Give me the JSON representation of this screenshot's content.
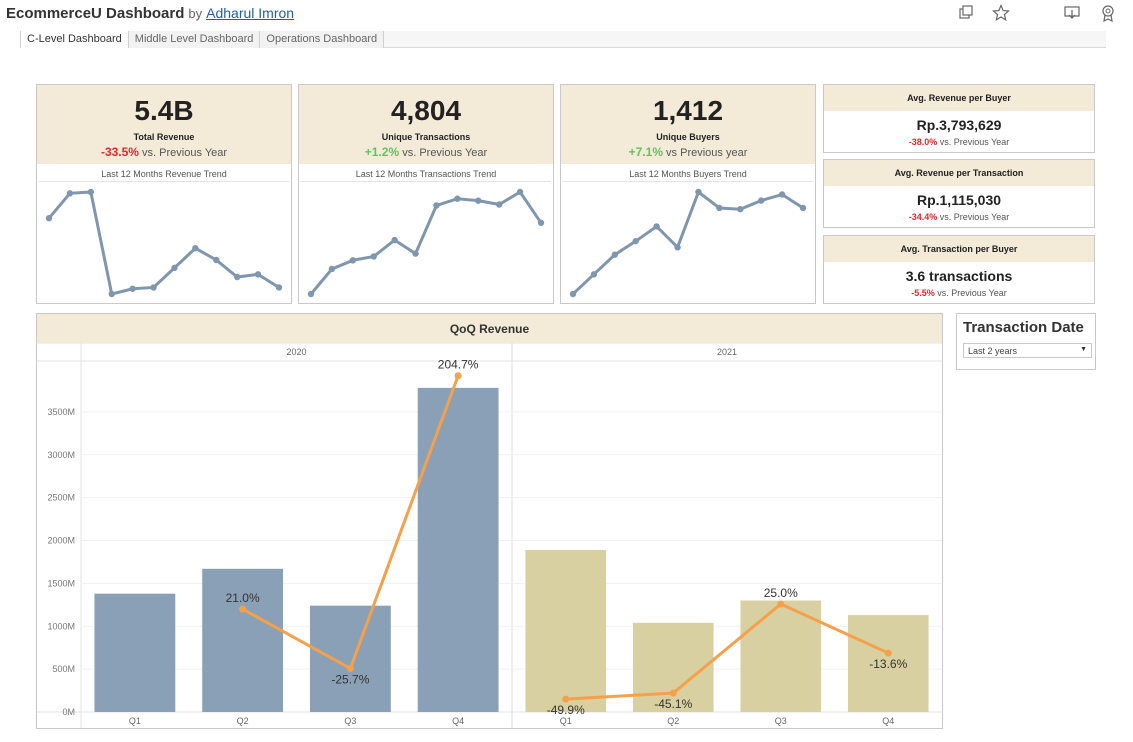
{
  "header": {
    "title": "EcommerceU Dashboard",
    "by": "by",
    "author": "Adharul Imron",
    "icons": [
      "copy-icon",
      "star-icon",
      "download-icon",
      "badge-icon"
    ]
  },
  "tabs": [
    {
      "label": "C-Level Dashboard",
      "active": true
    },
    {
      "label": "Middle Level Dashboard",
      "active": false
    },
    {
      "label": "Operations Dashboard",
      "active": false
    }
  ],
  "kpis": [
    {
      "value": "5.4B",
      "label": "Total Revenue",
      "change": "-33.5%",
      "change_text": "vs. Previous Year",
      "trend": "negative",
      "spark_title": "Last 12 Months Revenue Trend",
      "spark": [
        60,
        79,
        80,
        2,
        6,
        7,
        22,
        37,
        28,
        15,
        17,
        7
      ]
    },
    {
      "value": "4,804",
      "label": "Unique Transactions",
      "change": "+1.2%",
      "change_text": "vs. Previous Year",
      "trend": "positive",
      "spark_title": "Last 12 Months Transactions Trend",
      "spark": [
        3,
        29,
        38,
        42,
        59,
        45,
        95,
        102,
        100,
        96,
        109,
        77
      ]
    },
    {
      "value": "1,412",
      "label": "Unique Buyers",
      "change": "+7.1%",
      "change_text": "vs Previous year",
      "trend": "positive",
      "spark_title": "Last 12 Months Buyers Trend",
      "spark": [
        2,
        18,
        34,
        45,
        57,
        40,
        85,
        72,
        71,
        78,
        83,
        72
      ]
    }
  ],
  "small_kpis": [
    {
      "title": "Avg. Revenue per Buyer",
      "value": "Rp.3,793,629",
      "change": "-38.0%",
      "change_text": "vs. Previous Year"
    },
    {
      "title": "Avg. Revenue per Transaction",
      "value": "Rp.1,115,030",
      "change": "-34.4%",
      "change_text": "vs. Previous Year"
    },
    {
      "title": "Avg. Transaction per Buyer",
      "value": "3.6 transactions",
      "change": "-5.5%",
      "change_text": "vs. Previous Year"
    }
  ],
  "filter": {
    "title": "Transaction Date",
    "selected": "Last 2 years"
  },
  "colors": {
    "header_bg": "#f3ead7",
    "bar_2020": "#8aa0b6",
    "bar_2021": "#d8d0a0",
    "growth_line": "#f5a04a",
    "spark_line": "#7f96ad",
    "negative": "#e4262c",
    "positive": "#5fc45f"
  },
  "chart_data": {
    "type": "bar",
    "title": "QoQ Revenue",
    "panels": [
      "2020",
      "2021"
    ],
    "categories": [
      "Q1",
      "Q2",
      "Q3",
      "Q4"
    ],
    "series": [
      {
        "name": "2020",
        "values": [
          1380,
          1670,
          1240,
          3780
        ]
      },
      {
        "name": "2021",
        "values": [
          1890,
          1040,
          1300,
          1130
        ]
      }
    ],
    "growth": [
      {
        "panel": "2020",
        "values": [
          null,
          21.0,
          -25.7,
          204.7
        ],
        "labels": [
          "",
          "21.0%",
          "-25.7%",
          "204.7%"
        ]
      },
      {
        "panel": "2021",
        "values": [
          -49.9,
          -45.1,
          25.0,
          -13.6
        ],
        "labels": [
          "-49.9%",
          "-45.1%",
          "25.0%",
          "-13.6%"
        ]
      }
    ],
    "y_ticks": [
      "0M",
      "500M",
      "1000M",
      "1500M",
      "2000M",
      "2500M",
      "3000M",
      "3500M"
    ],
    "ylim": [
      0,
      4000
    ],
    "growth_lim": [
      -60,
      210
    ]
  }
}
